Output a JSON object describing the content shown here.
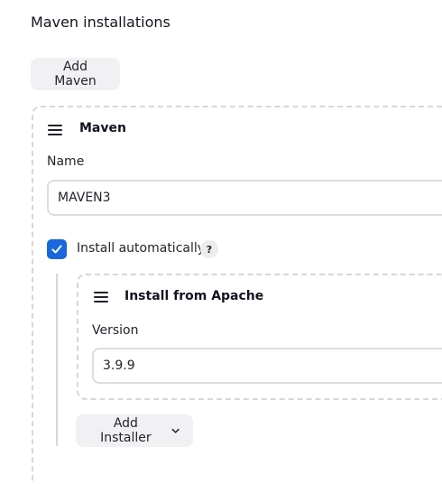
{
  "section": {
    "title": "Maven installations"
  },
  "add_maven_button": {
    "label": "Add Maven"
  },
  "installation": {
    "card_title": "Maven",
    "name_label": "Name",
    "name_value": "MAVEN3",
    "install_auto_label": "Install automatically",
    "install_auto_checked": true,
    "help_glyph": "?",
    "installer": {
      "card_title": "Install from Apache",
      "version_label": "Version",
      "version_value": "3.9.9"
    },
    "add_installer_button": {
      "label": "Add Installer"
    }
  },
  "icons": {
    "drag": "drag-handle-icon",
    "check": "check-icon",
    "help": "help-icon",
    "chevron": "chevron-down-icon"
  },
  "colors": {
    "accent": "#1868db",
    "button_bg": "#f1f1f4",
    "border": "#d6d6dc"
  }
}
